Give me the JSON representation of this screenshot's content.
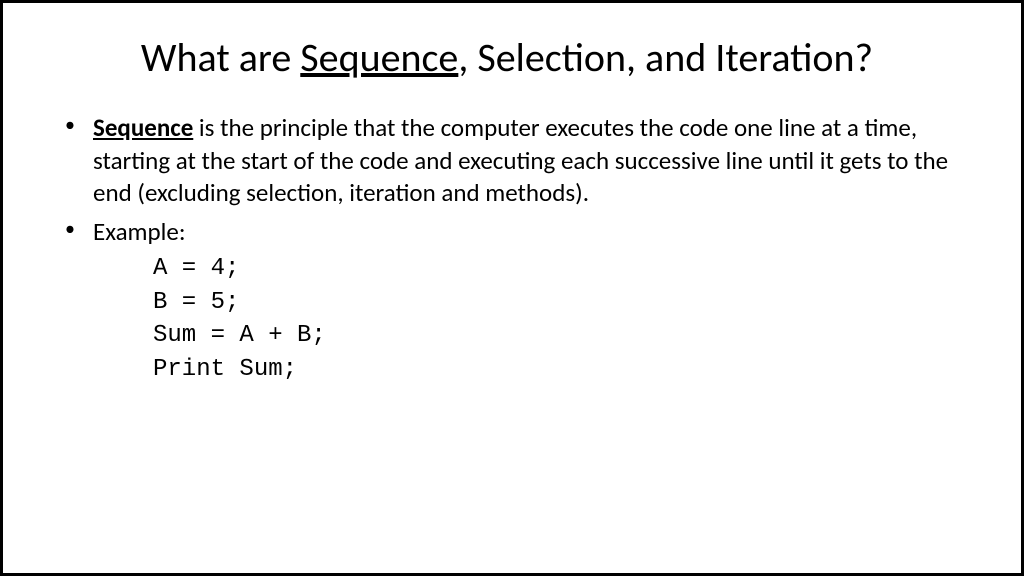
{
  "title": {
    "prefix": "What are ",
    "underlined": "Sequence",
    "suffix": ", Selection, and Iteration?"
  },
  "bullets": {
    "first": {
      "bold": "Sequence",
      "rest": " is the principle that the computer executes the code one line at a time, starting at the start of the code and executing each successive line until it gets to the end (excluding selection, iteration and methods)."
    },
    "second": "Example:"
  },
  "code": {
    "line1": "A = 4;",
    "line2": "B = 5;",
    "line3": "Sum = A + B;",
    "line4": "Print Sum;"
  }
}
